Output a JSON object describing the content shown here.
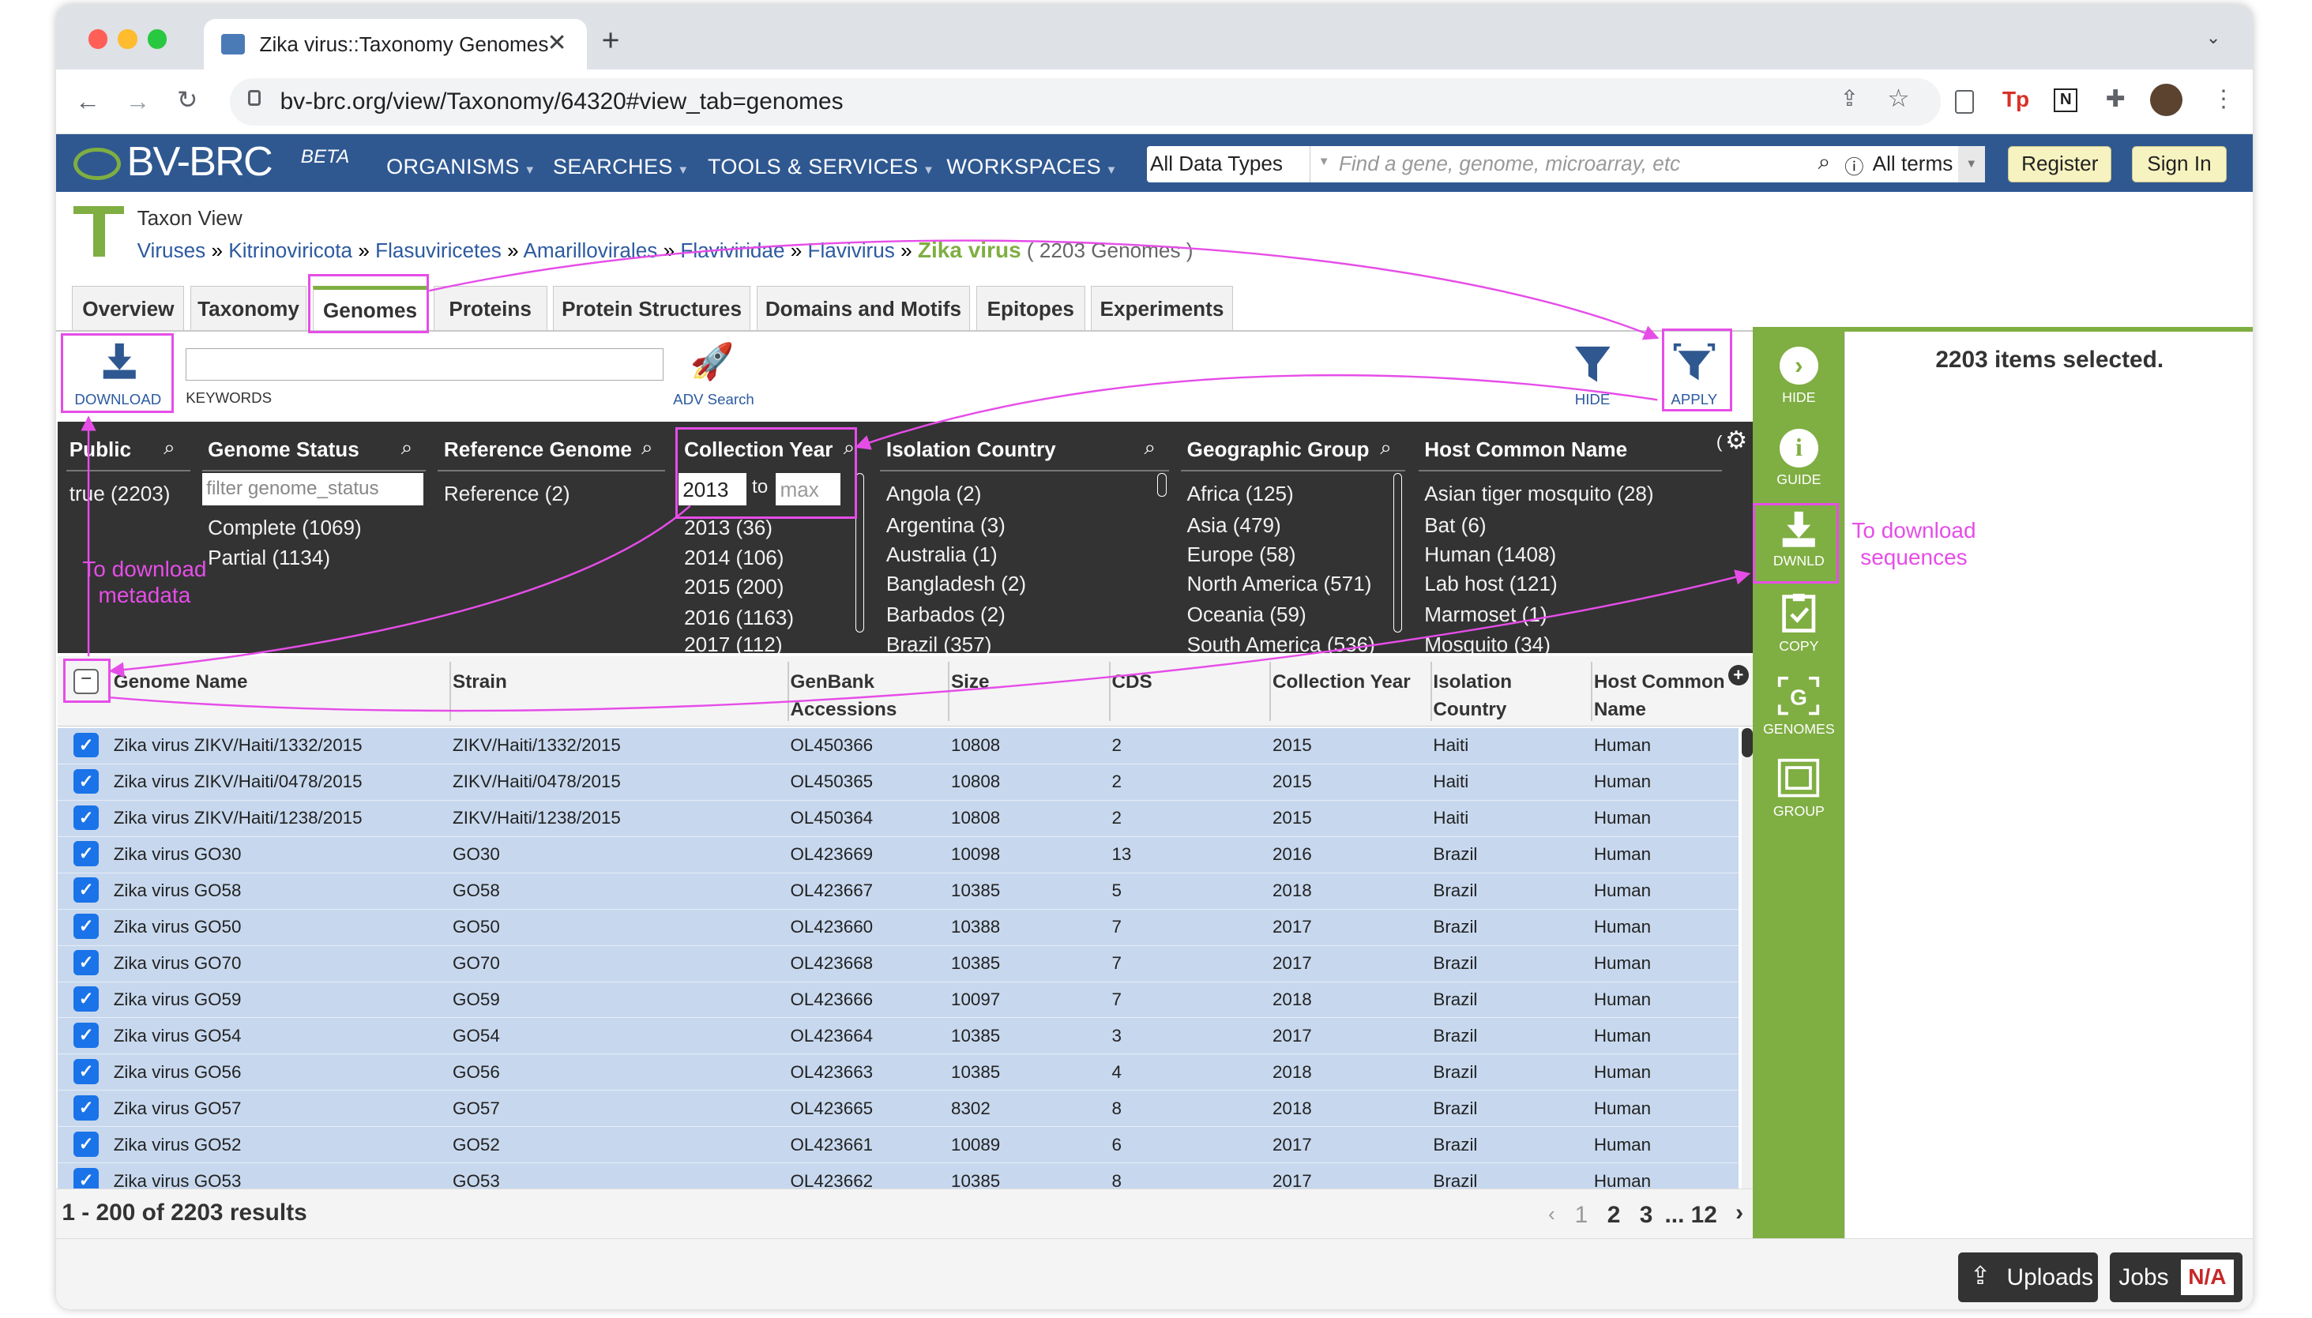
{
  "browser": {
    "tab_title": "Zika virus::Taxonomy Genomes",
    "url": "bv-brc.org/view/Taxonomy/64320#view_tab=genomes"
  },
  "site": {
    "logo": "BV-BRC",
    "logo_suffix": "BETA",
    "menus": [
      "ORGANISMS",
      "SEARCHES",
      "TOOLS & SERVICES",
      "WORKSPACES"
    ],
    "search_scope": "All Data Types",
    "search_placeholder": "Find a gene, genome, microarray, etc",
    "search_terms": "All terms",
    "register_label": "Register",
    "signin_label": "Sign In"
  },
  "taxon": {
    "view_label": "Taxon View",
    "breadcrumb": [
      "Viruses",
      "Kitrinoviricota",
      "Flasuviricetes",
      "Amarillovirales",
      "Flaviviridae",
      "Flavivirus"
    ],
    "current": "Zika virus",
    "genome_count": "( 2203 Genomes )",
    "tabs": [
      "Overview",
      "Taxonomy",
      "Genomes",
      "Proteins",
      "Protein Structures",
      "Domains and Motifs",
      "Epitopes",
      "Experiments"
    ],
    "active_tab": "Genomes"
  },
  "toolbar": {
    "download_label": "DOWNLOAD",
    "keywords_label": "KEYWORDS",
    "adv_search_label": "ADV Search",
    "hide_label": "HIDE",
    "apply_label": "APPLY"
  },
  "filters": {
    "public": {
      "title": "Public",
      "items": [
        "true (2203)"
      ]
    },
    "genome_status": {
      "title": "Genome Status",
      "placeholder": "filter genome_status",
      "items": [
        "Complete (1069)",
        "Partial (1134)"
      ]
    },
    "reference_genome": {
      "title": "Reference Genome",
      "items": [
        "Reference (2)"
      ]
    },
    "collection_year": {
      "title": "Collection Year",
      "min_value": "2013",
      "to_label": "to",
      "max_placeholder": "max",
      "items": [
        "2013 (36)",
        "2014 (106)",
        "2015 (200)",
        "2016 (1163)",
        "2017 (112)"
      ]
    },
    "isolation_country": {
      "title": "Isolation Country",
      "items": [
        "Angola (2)",
        "Argentina (3)",
        "Australia (1)",
        "Bangladesh (2)",
        "Barbados (2)",
        "Brazil (357)"
      ]
    },
    "geographic_group": {
      "title": "Geographic Group",
      "items": [
        "Africa (125)",
        "Asia (479)",
        "Europe (58)",
        "North America (571)",
        "Oceania (59)",
        "South America (536)"
      ]
    },
    "host_common_name": {
      "title": "Host Common Name",
      "items": [
        "Asian tiger mosquito (28)",
        "Bat (6)",
        "Human (1408)",
        "Lab host (121)",
        "Marmoset (1)",
        "Mosquito (34)"
      ]
    }
  },
  "grid": {
    "columns": [
      "Genome Name",
      "Strain",
      "GenBank Accessions",
      "Size",
      "CDS",
      "Collection Year",
      "Isolation Country",
      "Host Common Name"
    ],
    "rows": [
      [
        "Zika virus ZIKV/Haiti/1332/2015",
        "ZIKV/Haiti/1332/2015",
        "OL450366",
        "10808",
        "2",
        "2015",
        "Haiti",
        "Human"
      ],
      [
        "Zika virus ZIKV/Haiti/0478/2015",
        "ZIKV/Haiti/0478/2015",
        "OL450365",
        "10808",
        "2",
        "2015",
        "Haiti",
        "Human"
      ],
      [
        "Zika virus ZIKV/Haiti/1238/2015",
        "ZIKV/Haiti/1238/2015",
        "OL450364",
        "10808",
        "2",
        "2015",
        "Haiti",
        "Human"
      ],
      [
        "Zika virus GO30",
        "GO30",
        "OL423669",
        "10098",
        "13",
        "2016",
        "Brazil",
        "Human"
      ],
      [
        "Zika virus GO58",
        "GO58",
        "OL423667",
        "10385",
        "5",
        "2018",
        "Brazil",
        "Human"
      ],
      [
        "Zika virus GO50",
        "GO50",
        "OL423660",
        "10388",
        "7",
        "2017",
        "Brazil",
        "Human"
      ],
      [
        "Zika virus GO70",
        "GO70",
        "OL423668",
        "10385",
        "7",
        "2017",
        "Brazil",
        "Human"
      ],
      [
        "Zika virus GO59",
        "GO59",
        "OL423666",
        "10097",
        "7",
        "2018",
        "Brazil",
        "Human"
      ],
      [
        "Zika virus GO54",
        "GO54",
        "OL423664",
        "10385",
        "3",
        "2017",
        "Brazil",
        "Human"
      ],
      [
        "Zika virus GO56",
        "GO56",
        "OL423663",
        "10385",
        "4",
        "2018",
        "Brazil",
        "Human"
      ],
      [
        "Zika virus GO57",
        "GO57",
        "OL423665",
        "8302",
        "8",
        "2018",
        "Brazil",
        "Human"
      ],
      [
        "Zika virus GO52",
        "GO52",
        "OL423661",
        "10089",
        "6",
        "2017",
        "Brazil",
        "Human"
      ],
      [
        "Zika virus GO53",
        "GO53",
        "OL423662",
        "10385",
        "8",
        "2017",
        "Brazil",
        "Human"
      ]
    ],
    "results_summary": "1 - 200 of 2203 results",
    "pages": [
      "1",
      "2",
      "3",
      "... 12"
    ]
  },
  "selection": {
    "summary": "2203 items selected."
  },
  "actions": [
    "HIDE",
    "GUIDE",
    "DWNLD",
    "COPY",
    "GENOMES",
    "GROUP"
  ],
  "footer": {
    "uploads_label": "Uploads",
    "jobs_label": "Jobs",
    "jobs_status": "N/A"
  },
  "annotations": {
    "metadata_note": "To download metadata",
    "sequences_note": "To download sequences"
  },
  "colors": {
    "site_header": "#2f5891",
    "filter_panel": "#333333",
    "selected_row": "#c7d8ee",
    "action_bar": "#7fae42",
    "annotation": "#e64de8",
    "checkbox": "#1a73e8"
  }
}
